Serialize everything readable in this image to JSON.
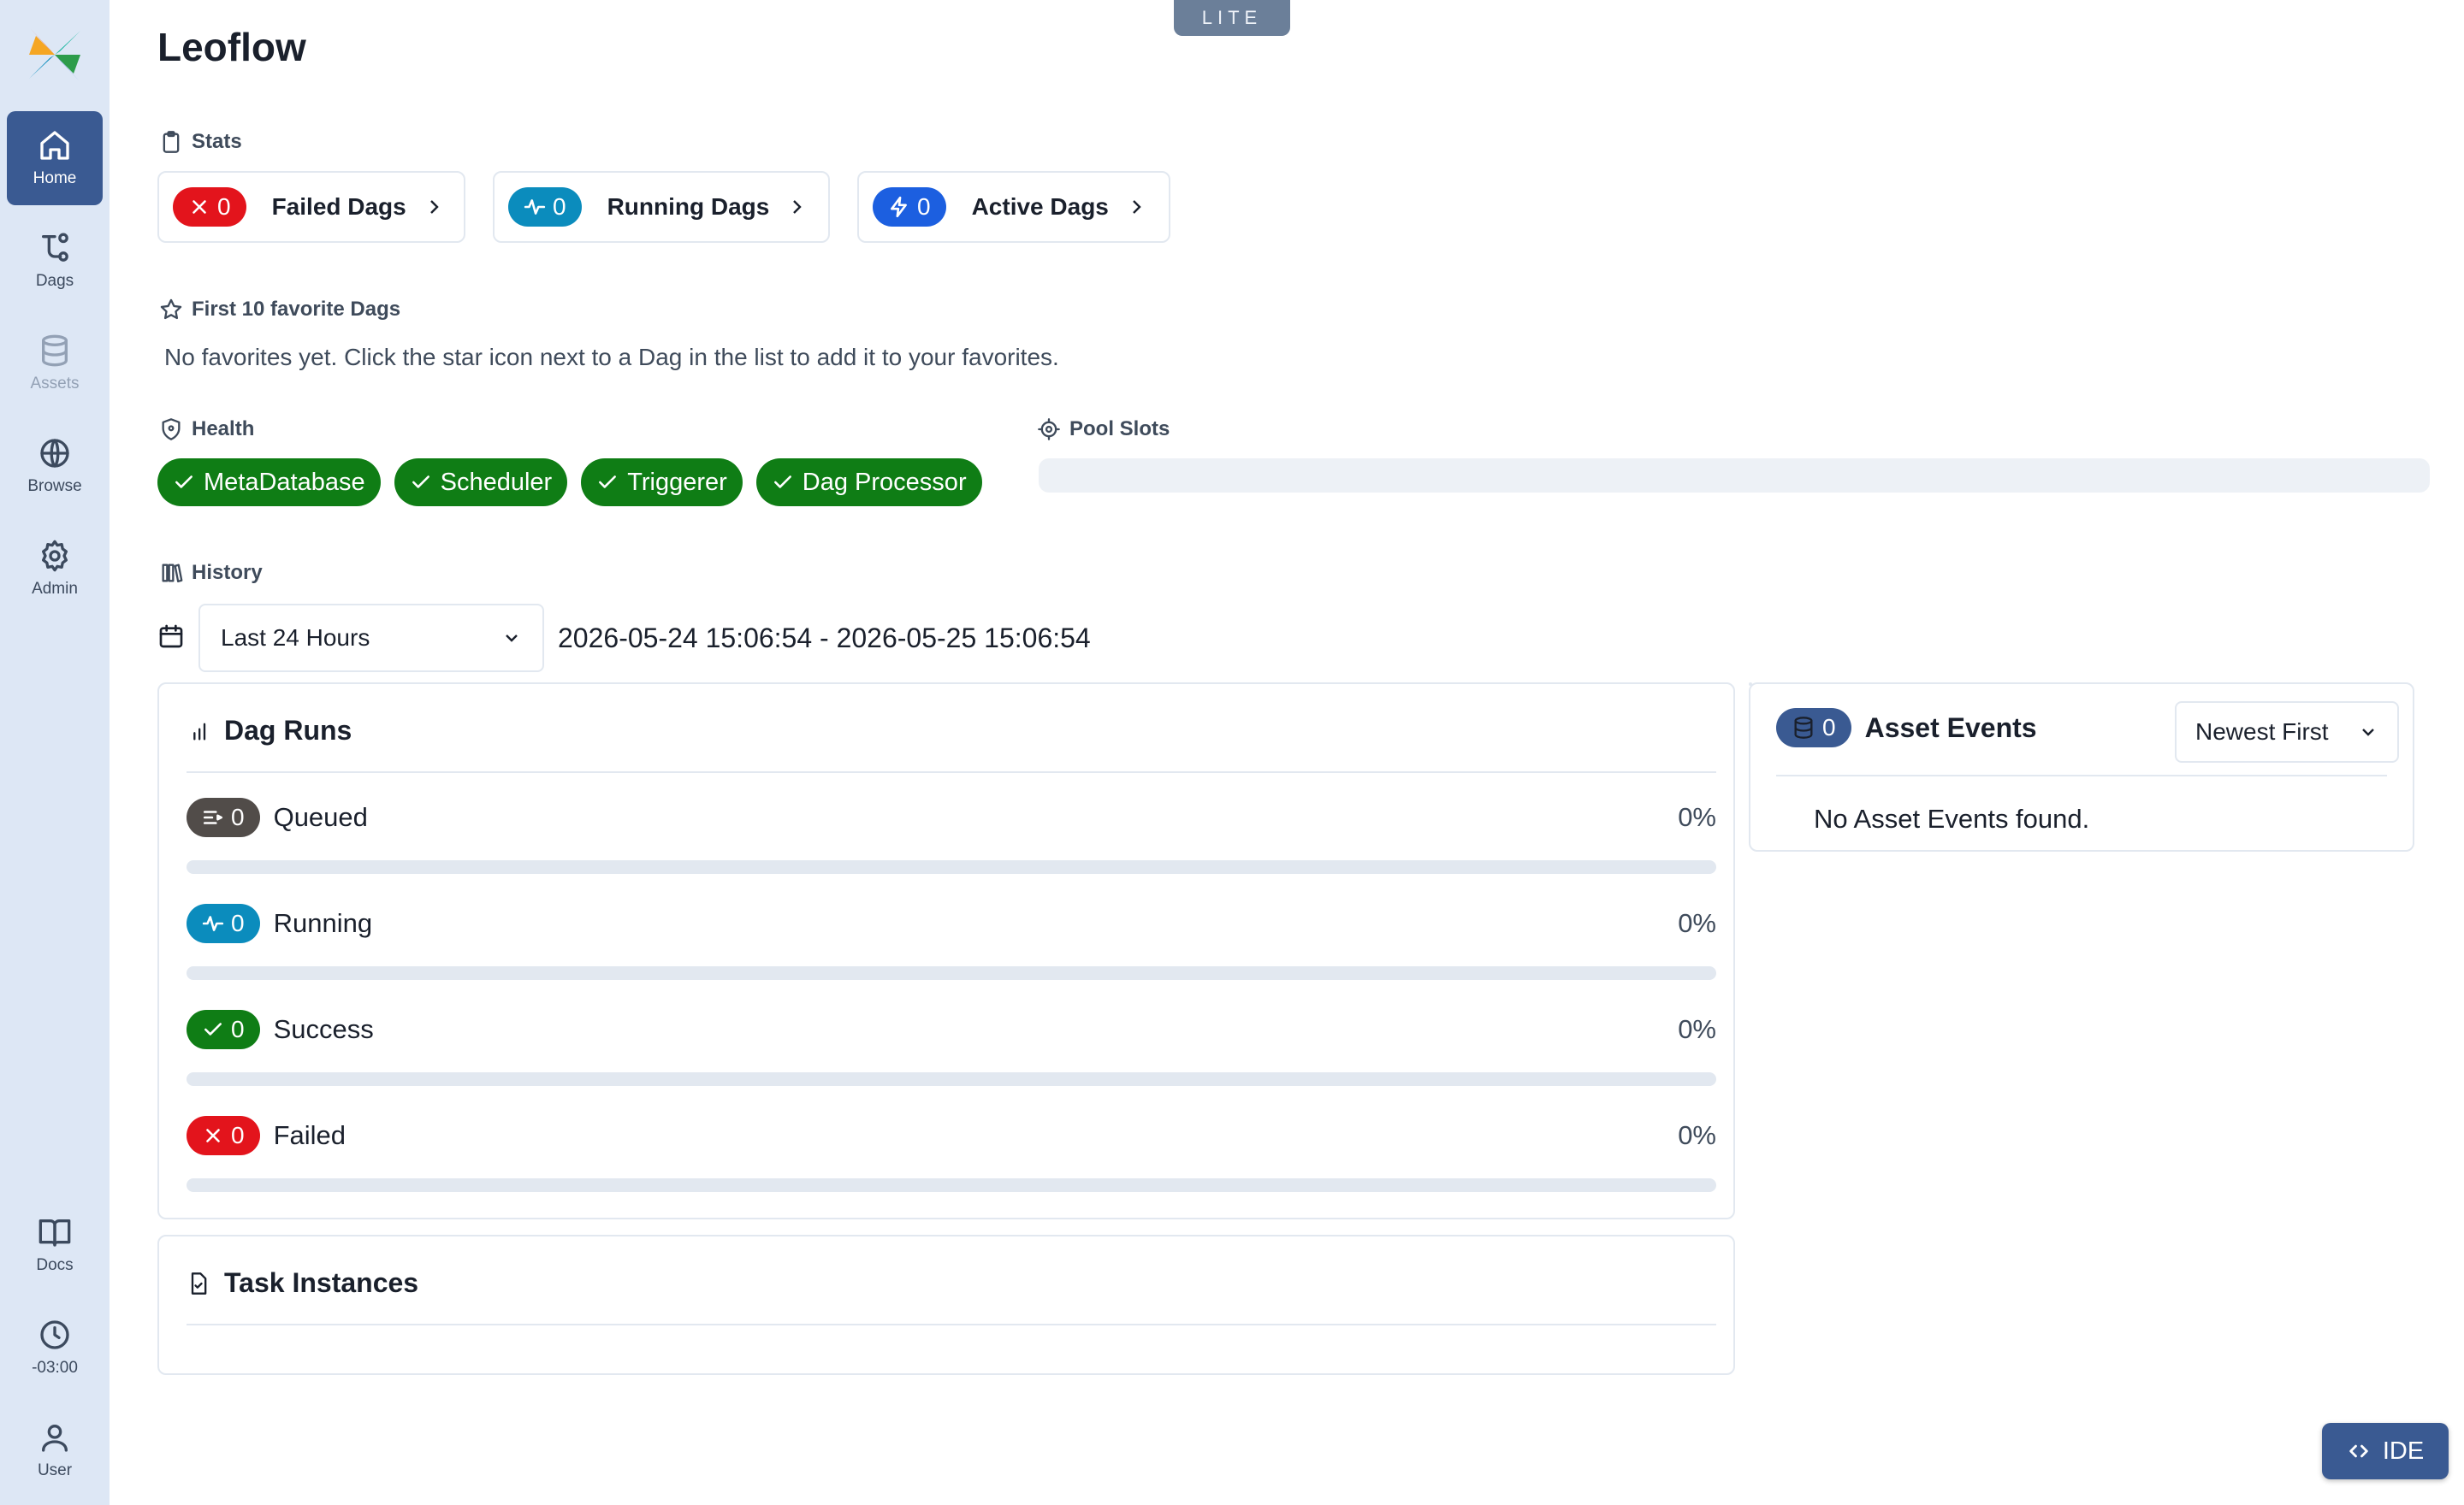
{
  "app": {
    "title": "Leoflow",
    "badge": "LITE"
  },
  "sidebar": {
    "items": [
      {
        "label": "Home",
        "icon": "home-icon",
        "active": true
      },
      {
        "label": "Dags",
        "icon": "dags-icon"
      },
      {
        "label": "Assets",
        "icon": "database-icon"
      },
      {
        "label": "Browse",
        "icon": "globe-icon"
      },
      {
        "label": "Admin",
        "icon": "gear-icon"
      },
      {
        "label": "Docs",
        "icon": "book-icon"
      },
      {
        "label": "-03:00",
        "icon": "clock-icon"
      },
      {
        "label": "User",
        "icon": "user-icon"
      }
    ]
  },
  "stats": {
    "label": "Stats",
    "cards": [
      {
        "count": "0",
        "label": "Failed Dags",
        "color": "#e3141c"
      },
      {
        "count": "0",
        "label": "Running Dags",
        "color": "#0b8cbd"
      },
      {
        "count": "0",
        "label": "Active Dags",
        "color": "#1c5fe0"
      }
    ]
  },
  "favorites": {
    "label": "First 10 favorite Dags",
    "empty": "No favorites yet. Click the star icon next to a Dag in the list to add it to your favorites."
  },
  "health": {
    "label": "Health",
    "items": [
      "MetaDatabase",
      "Scheduler",
      "Triggerer",
      "Dag Processor"
    ],
    "color": "#0f7d15"
  },
  "pool_slots": {
    "label": "Pool Slots"
  },
  "history": {
    "label": "History",
    "range_value": "Last 24 Hours",
    "range_text": "2026-05-24 15:06:54 - 2026-05-25 15:06:54"
  },
  "dag_runs": {
    "title": "Dag Runs",
    "rows": [
      {
        "count": "0",
        "label": "Queued",
        "pct": "0%",
        "color": "#514c49"
      },
      {
        "count": "0",
        "label": "Running",
        "pct": "0%",
        "color": "#0b8cbd"
      },
      {
        "count": "0",
        "label": "Success",
        "pct": "0%",
        "color": "#0f7d15"
      },
      {
        "count": "0",
        "label": "Failed",
        "pct": "0%",
        "color": "#e3141c"
      }
    ]
  },
  "task_instances": {
    "title": "Task Instances"
  },
  "asset_events": {
    "count": "0",
    "title": "Asset Events",
    "sort_value": "Newest First",
    "empty": "No Asset Events found."
  },
  "ide": {
    "label": "IDE"
  }
}
